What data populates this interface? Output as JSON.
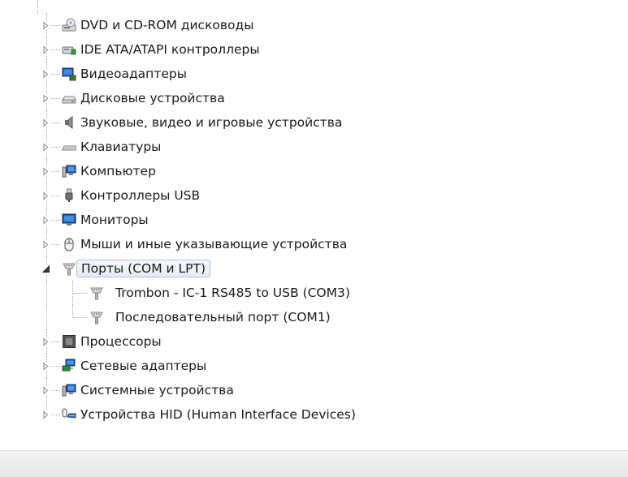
{
  "tree": {
    "categories": [
      {
        "label": "DVD и CD-ROM дисководы",
        "icon": "dvd-drive-icon",
        "expanded": false
      },
      {
        "label": "IDE ATA/ATAPI контроллеры",
        "icon": "ide-controller-icon",
        "expanded": false
      },
      {
        "label": "Видеоадаптеры",
        "icon": "video-adapter-icon",
        "expanded": false
      },
      {
        "label": "Дисковые устройства",
        "icon": "disk-drive-icon",
        "expanded": false
      },
      {
        "label": "Звуковые, видео и игровые устройства",
        "icon": "speaker-icon",
        "expanded": false
      },
      {
        "label": "Клавиатуры",
        "icon": "keyboard-icon",
        "expanded": false
      },
      {
        "label": "Компьютер",
        "icon": "computer-icon",
        "expanded": false
      },
      {
        "label": "Контроллеры USB",
        "icon": "usb-plug-icon",
        "expanded": false
      },
      {
        "label": "Мониторы",
        "icon": "monitor-icon",
        "expanded": false
      },
      {
        "label": "Мыши и иные указывающие устройства",
        "icon": "mouse-icon",
        "expanded": false
      },
      {
        "label": "Порты (COM и LPT)",
        "icon": "port-icon",
        "expanded": true,
        "selected": true
      },
      {
        "label": "Процессоры",
        "icon": "processor-icon",
        "expanded": false
      },
      {
        "label": "Сетевые адаптеры",
        "icon": "network-adapter-icon",
        "expanded": false
      },
      {
        "label": "Системные устройства",
        "icon": "system-device-icon",
        "expanded": false
      },
      {
        "label": "Устройства HID (Human Interface Devices)",
        "icon": "hid-device-icon",
        "expanded": false
      }
    ],
    "ports_children": [
      {
        "label": "Trombon - IC-1  RS485 to USB (COM3)",
        "icon": "port-icon"
      },
      {
        "label": "Последовательный порт (COM1)",
        "icon": "port-icon"
      }
    ]
  },
  "colors": {
    "selection_border": "#a9c3e1",
    "selection_fill": "#e3edf8"
  }
}
